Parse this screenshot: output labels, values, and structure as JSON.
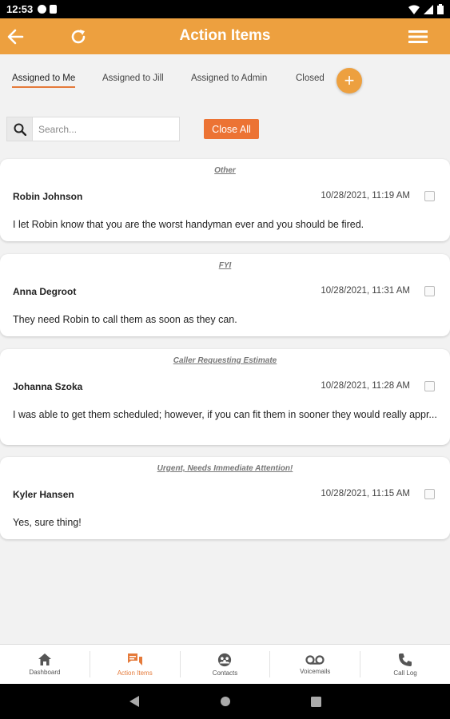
{
  "status_bar": {
    "time": "12:53"
  },
  "app_bar": {
    "title": "Action Items"
  },
  "tabs": [
    {
      "label": "Assigned to Me",
      "active": true
    },
    {
      "label": "Assigned to Jill",
      "active": false
    },
    {
      "label": "Assigned to Admin",
      "active": false
    },
    {
      "label": "Closed",
      "active": false
    }
  ],
  "search": {
    "placeholder": "Search..."
  },
  "close_all_label": "Close All",
  "items": [
    {
      "category": "Other",
      "name": "Robin Johnson",
      "date": "10/28/2021, 11:19 AM",
      "message": "I let Robin know that you are the worst handyman ever and you should be fired."
    },
    {
      "category": "FYI",
      "name": "Anna Degroot",
      "date": "10/28/2021, 11:31 AM",
      "message": "They need Robin to call them as soon as they can."
    },
    {
      "category": "Caller Requesting Estimate",
      "name": "Johanna Szoka",
      "date": "10/28/2021, 11:28 AM",
      "message": "I was able to get them scheduled; however, if you can fit them in sooner they would really appr..."
    },
    {
      "category": "Urgent, Needs Immediate Attention!",
      "name": "Kyler Hansen",
      "date": "10/28/2021, 11:15 AM",
      "message": "Yes, sure thing!"
    }
  ],
  "bottom_nav": [
    {
      "label": "Dashboard",
      "icon": "home-icon"
    },
    {
      "label": "Action Items",
      "icon": "chat-icon",
      "active": true
    },
    {
      "label": "Contacts",
      "icon": "contacts-icon"
    },
    {
      "label": "Voicemails",
      "icon": "voicemail-icon"
    },
    {
      "label": "Call Log",
      "icon": "phone-icon"
    }
  ],
  "colors": {
    "brand": "#eda03f",
    "accent": "#ec7334"
  }
}
